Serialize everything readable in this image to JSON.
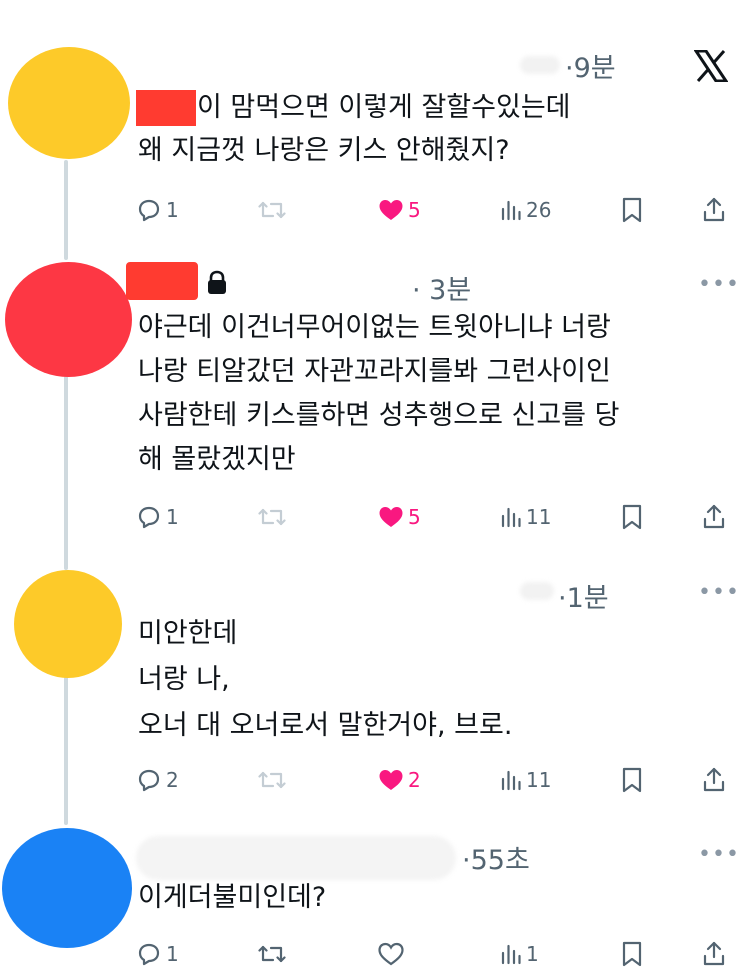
{
  "header": {
    "logo": "x-logo-icon"
  },
  "tweets": [
    {
      "time": "·9분",
      "lines": [
        "이 맘먹으면 이렇게 잘할수있는데",
        "왜 지금껏 나랑은 키스 안해줬지?"
      ],
      "replies": "1",
      "likes": "5",
      "views": "26",
      "liked": true
    },
    {
      "time": "· 3분",
      "lines": [
        "야근데 이건너무어이없는 트윗아니냐 너랑",
        "나랑 티알갔던 자관꼬라지를봐 그런사이인",
        "사람한테 키스를하면 성추행으로 신고를 당",
        "해 몰랐겠지만"
      ],
      "replies": "1",
      "likes": "5",
      "views": "11",
      "liked": true
    },
    {
      "time": "·1분",
      "lines": [
        "미안한데",
        "너랑 나,",
        "오너 대 오너로서 말한거야, 브로."
      ],
      "replies": "2",
      "likes": "2",
      "views": "11",
      "liked": true
    },
    {
      "time": "·55초",
      "lines": [
        "이게더불미인데?"
      ],
      "replies": "1",
      "likes": "",
      "views": "1",
      "liked": false
    }
  ],
  "colors": {
    "like_pink": "#f91880",
    "icon_gray": "#536471",
    "avatar_yellow": "#fdca29",
    "avatar_red": "#fd3744",
    "avatar_blue": "#1a82f5"
  }
}
